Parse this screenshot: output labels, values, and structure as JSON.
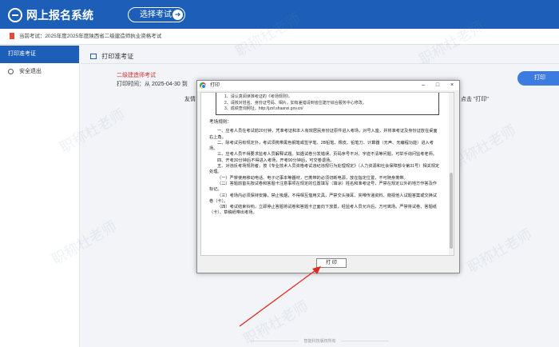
{
  "header": {
    "app_title": "网上报名系统",
    "select_exam_label": "选择考试",
    "select_exam_icon": "arrow-right-icon"
  },
  "current_exam": "当前考试：2025年度2025年度陕西省二级建造师执业资格考试",
  "sidebar": {
    "items": [
      {
        "label": "打印准考证",
        "active": true
      },
      {
        "label": "安全退出",
        "active": false
      }
    ]
  },
  "main": {
    "title": "打印准考证",
    "cert_name": "二级建造师考试",
    "print_time": "打印时间：从 2025-04-30 到",
    "note_left": "友情",
    "note_right": "点击 \"打印\"",
    "print_button": "打印",
    "footer": "智能科技版权所有"
  },
  "dialog": {
    "title": "打印",
    "minimize": "–",
    "maximize": "□",
    "close": "×",
    "box_lines": [
      "1、请认真阅读准考证的《考场规则》。",
      "2、请核对姓名、身份证号码、相片，如有差错请到省住建厅综合服务中心修改。",
      "3、成绩查询网址。http://jzsf.shaanxi.gov.cn/"
    ],
    "rules_heading": "考场规则：",
    "rules": [
      "一、应考人员在考试前20分钟，凭准考证和本人有效居民身份证原件进入考场，对号入座，并将准考证及身份证放在桌面右上角。",
      "二、除考试另有规定外，考试须携带黑色钢笔或签字笔、2B铅笔、橡皮、铅笔刀、计算器（无声、无编程功能）进入考场。",
      "三、应考人员不得要求监考人员解释试题。如遇试卷分发错误、页码序号不对、字迹不清等问题，可举手询问监考老师。",
      "四、开考30分钟后不得进入考场，开考90分钟后，可交卷退场。",
      "五、对违反考场规则者，按《专业技术人员资格考试违纪违规行为处理规定》（人力资源和社会保障部令第31号）相关规定处理。",
      "（一）严禁使用移动电话、电子记事本等器材，已携带的必须切断电源，放在指定位置，不可随身携带。",
      "（二）答题前首先按试卷和答题卡注意事项在规定的位置填写（填涂）姓名和准考证号，严禁在规定以外的地方作答及作标记。",
      "（三）考场内必须保持安静，禁止吸烟，不得相互借用文具，严禁交头接耳、夹带传递资料、窥视他人试题答案或交换试卷（卡）。",
      "（四）考试结束铃响，立即停止答题将试卷和答题卡正面向下放置，经监考人员允许后，方可离场。严禁将试卷、答题纸（卡）、草稿纸带出考场。"
    ],
    "print_button": "打 印"
  },
  "watermark": "职称杜老师",
  "colors": {
    "header_blue": "#1d5fb8",
    "button_blue": "#3c7be0",
    "title_red": "#d0312d",
    "arrow_red": "#e0281f"
  }
}
